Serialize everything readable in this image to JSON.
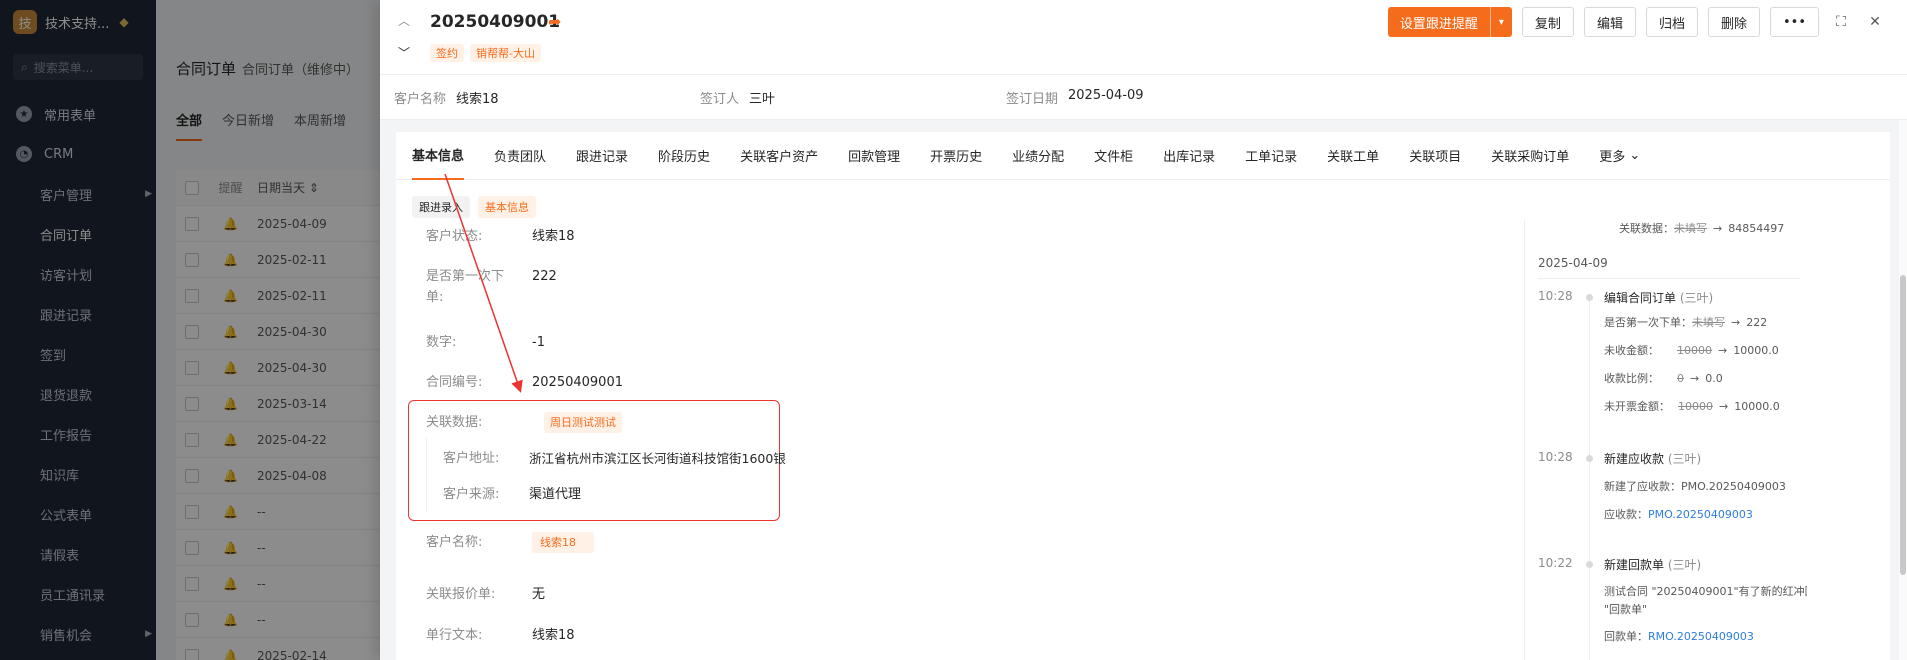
{
  "sidebar": {
    "brand_logo": "技",
    "brand_name": "技术支持...",
    "search_placeholder": "搜索菜单...",
    "groups": [
      {
        "label": "常用表单",
        "icon": "star-icon"
      },
      {
        "label": "CRM",
        "icon": "pie-chart-icon"
      }
    ],
    "items": [
      "客户管理",
      "合同订单",
      "访客计划",
      "跟进记录",
      "签到",
      "退货退款",
      "工作报告",
      "知识库",
      "公式表单",
      "请假表",
      "员工通讯录",
      "销售机会"
    ]
  },
  "list_page": {
    "title": "合同订单",
    "subtitle": "合同订单（维修中）",
    "tabs": [
      "全部",
      "今日新增",
      "本周新增"
    ],
    "headers": {
      "remind": "提醒",
      "date": "日期当天"
    },
    "dates": [
      "2025-04-09",
      "2025-02-11",
      "2025-02-11",
      "2025-04-30",
      "2025-04-30",
      "2025-03-14",
      "2025-04-22",
      "2025-04-08",
      "--",
      "--",
      "--",
      "--",
      "2025-02-14"
    ]
  },
  "drawer": {
    "title": "20250409001",
    "tags": [
      "签约",
      "销帮帮-大山"
    ],
    "actions": {
      "primary": "设置跟进提醒",
      "copy": "复制",
      "edit": "编辑",
      "archive": "归档",
      "delete": "删除"
    },
    "summary": [
      {
        "label": "客户名称",
        "value": "线索18"
      },
      {
        "label": "签订人",
        "value": "三叶"
      },
      {
        "label": "签订日期",
        "value": "2025-04-09"
      }
    ],
    "tabs": [
      "基本信息",
      "负责团队",
      "跟进记录",
      "阶段历史",
      "关联客户资产",
      "回款管理",
      "开票历史",
      "业绩分配",
      "文件柜",
      "出库记录",
      "工单记录",
      "关联工单",
      "关联项目",
      "关联采购订单",
      "更多"
    ],
    "subtags": [
      "跟进录入",
      "基本信息"
    ],
    "fields": {
      "customer_status": {
        "label": "客户状态:",
        "value": "线索18"
      },
      "first_order": {
        "label": "是否第一次下单:",
        "value": "222"
      },
      "number": {
        "label": "数字:",
        "value": "-1"
      },
      "contract_no": {
        "label": "合同编号:",
        "value": "20250409001"
      },
      "related_data": {
        "label": "关联数据:",
        "value": "周日测试测试"
      },
      "customer_address": {
        "label": "客户地址:",
        "value": "浙江省杭州市滨江区长河街道科技馆街1600银"
      },
      "customer_source": {
        "label": "客户来源:",
        "value": "渠道代理"
      },
      "customer_name": {
        "label": "客户名称:",
        "value": "线索18"
      },
      "related_quote": {
        "label": "关联报价单:",
        "value": "无"
      },
      "single_text": {
        "label": "单行文本:",
        "value": "线索18"
      }
    },
    "timeline": {
      "top_line": {
        "label": "关联数据：",
        "old": "未填写",
        "new": "84854497"
      },
      "date": "2025-04-09",
      "entries": [
        {
          "time": "10:28",
          "title": "编辑合同订单",
          "who": "(三叶)",
          "lines": [
            {
              "label": "是否第一次下单：",
              "old": "未填写",
              "new": "222"
            },
            {
              "label": "未收金额：",
              "old": "10000",
              "new": "10000.0"
            },
            {
              "label": "收款比例：",
              "old": "0",
              "new": "0.0"
            },
            {
              "label": "未开票金额：",
              "old": "10000",
              "new": "10000.0"
            }
          ]
        },
        {
          "time": "10:28",
          "title": "新建应收款",
          "who": "(三叶)",
          "text": "新建了应收款：PMO.20250409003",
          "link_label": "应收款：",
          "link": "PMO.20250409003"
        },
        {
          "time": "10:22",
          "title": "新建回款单",
          "who": "(三叶)",
          "text1": "测试合同 \"20250409001\"有了新的红冲回款单",
          "text2": "\"回款单\"",
          "link_label": "回款单：",
          "link": "RMO.20250409003"
        }
      ]
    }
  },
  "colors": {
    "accent": "#f56c1d",
    "link": "#2f7de1",
    "highlight": "#e33333",
    "sidebar_bg": "#1f2937"
  }
}
